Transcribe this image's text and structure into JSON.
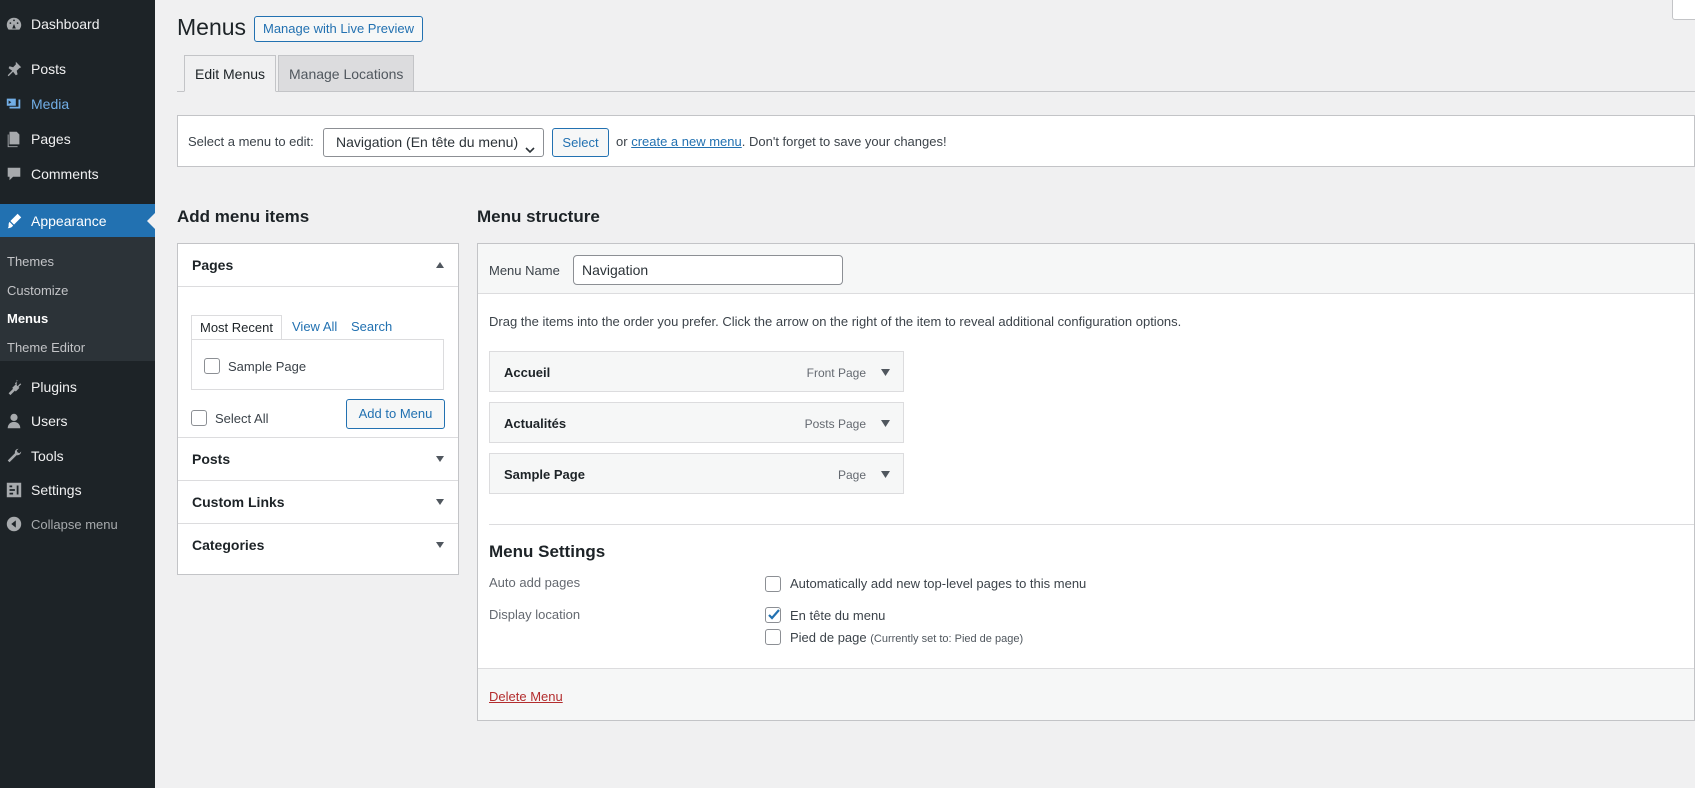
{
  "sidebar": {
    "items": [
      {
        "label": "Dashboard",
        "icon": "dashboard-icon"
      },
      {
        "label": "Posts",
        "icon": "pin-icon"
      },
      {
        "label": "Media",
        "icon": "media-icon"
      },
      {
        "label": "Pages",
        "icon": "pages-icon"
      },
      {
        "label": "Comments",
        "icon": "comment-icon"
      },
      {
        "label": "Appearance",
        "icon": "brush-icon"
      },
      {
        "label": "Plugins",
        "icon": "plug-icon"
      },
      {
        "label": "Users",
        "icon": "user-icon"
      },
      {
        "label": "Tools",
        "icon": "wrench-icon"
      },
      {
        "label": "Settings",
        "icon": "settings-icon"
      }
    ],
    "submenu": [
      "Themes",
      "Customize",
      "Menus",
      "Theme Editor"
    ],
    "collapse_label": "Collapse menu"
  },
  "header": {
    "title": "Menus",
    "live_preview_label": "Manage with Live Preview"
  },
  "tabs": [
    "Edit Menus",
    "Manage Locations"
  ],
  "manage": {
    "select_label": "Select a menu to edit:",
    "selected_menu": "Navigation (En tête du menu)",
    "select_button": "Select",
    "or_text": "or",
    "create_link": "create a new menu",
    "save_reminder": ". Don't forget to save your changes!"
  },
  "add_items": {
    "heading": "Add menu items",
    "sections": [
      "Pages",
      "Posts",
      "Custom Links",
      "Categories"
    ],
    "page_tabs": [
      "Most Recent",
      "View All",
      "Search"
    ],
    "pages": [
      {
        "label": "Sample Page",
        "checked": false
      }
    ],
    "select_all_label": "Select All",
    "add_button": "Add to Menu"
  },
  "structure": {
    "heading": "Menu structure",
    "name_label": "Menu Name",
    "name_value": "Navigation",
    "instructions": "Drag the items into the order you prefer. Click the arrow on the right of the item to reveal additional configuration options.",
    "items": [
      {
        "title": "Accueil",
        "type": "Front Page"
      },
      {
        "title": "Actualités",
        "type": "Posts Page"
      },
      {
        "title": "Sample Page",
        "type": "Page"
      }
    ]
  },
  "settings": {
    "heading": "Menu Settings",
    "auto_add_label": "Auto add pages",
    "auto_add_option": "Automatically add new top-level pages to this menu",
    "auto_add_checked": false,
    "display_location_label": "Display location",
    "locations": [
      {
        "label": "En tête du menu",
        "note": "",
        "checked": true
      },
      {
        "label": "Pied de page",
        "note": "(Currently set to: Pied de page)",
        "checked": false
      }
    ],
    "delete_label": "Delete Menu"
  },
  "colors": {
    "accent": "#2271b1",
    "sidebar_bg": "#1d2327",
    "delete": "#b32d2e"
  }
}
